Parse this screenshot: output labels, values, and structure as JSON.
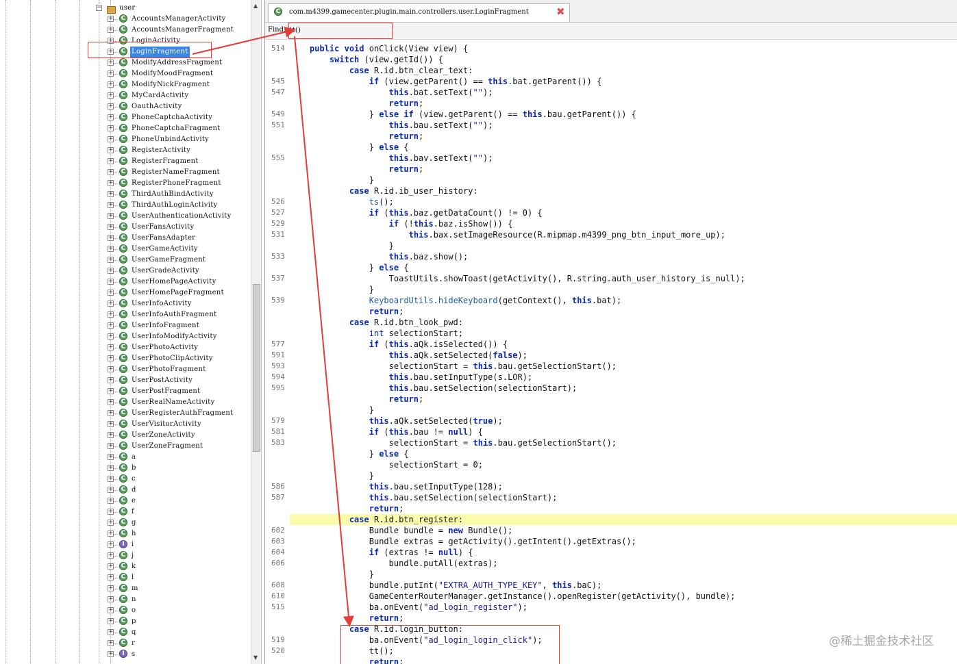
{
  "package_tree": {
    "root_label": "user",
    "nodes": [
      {
        "label": "AccountsManagerActivity",
        "kind": "class"
      },
      {
        "label": "AccountsManagerFragment",
        "kind": "class"
      },
      {
        "label": "LoginActivity",
        "kind": "class"
      },
      {
        "label": "LoginFragment",
        "kind": "class",
        "selected": true
      },
      {
        "label": "ModifyAddressFragment",
        "kind": "class"
      },
      {
        "label": "ModifyMoodFragment",
        "kind": "class"
      },
      {
        "label": "ModifyNickFragment",
        "kind": "class"
      },
      {
        "label": "MyCardActivity",
        "kind": "class"
      },
      {
        "label": "OauthActivity",
        "kind": "class"
      },
      {
        "label": "PhoneCaptchaActivity",
        "kind": "class"
      },
      {
        "label": "PhoneCaptchaFragment",
        "kind": "class"
      },
      {
        "label": "PhoneUnbindActivity",
        "kind": "class"
      },
      {
        "label": "RegisterActivity",
        "kind": "class"
      },
      {
        "label": "RegisterFragment",
        "kind": "class"
      },
      {
        "label": "RegisterNameFragment",
        "kind": "class"
      },
      {
        "label": "RegisterPhoneFragment",
        "kind": "class"
      },
      {
        "label": "ThirdAuthBindActivity",
        "kind": "class"
      },
      {
        "label": "ThirdAuthLoginActivity",
        "kind": "class"
      },
      {
        "label": "UserAuthenticationActivity",
        "kind": "class"
      },
      {
        "label": "UserFansActivity",
        "kind": "class"
      },
      {
        "label": "UserFansAdapter",
        "kind": "class"
      },
      {
        "label": "UserGameActivity",
        "kind": "class"
      },
      {
        "label": "UserGameFragment",
        "kind": "class"
      },
      {
        "label": "UserGradeActivity",
        "kind": "class"
      },
      {
        "label": "UserHomePageActivity",
        "kind": "class"
      },
      {
        "label": "UserHomePageFragment",
        "kind": "class"
      },
      {
        "label": "UserInfoActivity",
        "kind": "class"
      },
      {
        "label": "UserInfoAuthFragment",
        "kind": "class"
      },
      {
        "label": "UserInfoFragment",
        "kind": "class"
      },
      {
        "label": "UserInfoModifyActivity",
        "kind": "class"
      },
      {
        "label": "UserPhotoActivity",
        "kind": "class"
      },
      {
        "label": "UserPhotoClipActivity",
        "kind": "class"
      },
      {
        "label": "UserPhotoFragment",
        "kind": "class"
      },
      {
        "label": "UserPostActivity",
        "kind": "class"
      },
      {
        "label": "UserPostFragment",
        "kind": "class"
      },
      {
        "label": "UserRealNameActivity",
        "kind": "class"
      },
      {
        "label": "UserRegisterAuthFragment",
        "kind": "class"
      },
      {
        "label": "UserVisitorActivity",
        "kind": "class"
      },
      {
        "label": "UserZoneActivity",
        "kind": "class"
      },
      {
        "label": "UserZoneFragment",
        "kind": "class"
      },
      {
        "label": "a",
        "kind": "class"
      },
      {
        "label": "b",
        "kind": "class"
      },
      {
        "label": "c",
        "kind": "class"
      },
      {
        "label": "d",
        "kind": "class"
      },
      {
        "label": "e",
        "kind": "class"
      },
      {
        "label": "f",
        "kind": "class"
      },
      {
        "label": "g",
        "kind": "class"
      },
      {
        "label": "h",
        "kind": "class"
      },
      {
        "label": "i",
        "kind": "interface"
      },
      {
        "label": "j",
        "kind": "class"
      },
      {
        "label": "k",
        "kind": "class"
      },
      {
        "label": "l",
        "kind": "class"
      },
      {
        "label": "m",
        "kind": "class"
      },
      {
        "label": "n",
        "kind": "class"
      },
      {
        "label": "o",
        "kind": "class"
      },
      {
        "label": "p",
        "kind": "class"
      },
      {
        "label": "q",
        "kind": "class"
      },
      {
        "label": "r",
        "kind": "class"
      },
      {
        "label": "s",
        "kind": "interface"
      }
    ]
  },
  "editor": {
    "tab_title": "com.m4399.gamecenter.plugin.main.controllers.user.LoginFragment",
    "find_label": "Find:",
    "find_value": "tt()",
    "highlight_color": "#fbfbaa",
    "lines": [
      {
        "n": "514",
        "indent": 1,
        "html": "<span class='kw'>public</span> <span class='kw'>void</span> onClick(View view) {"
      },
      {
        "n": "",
        "indent": 2,
        "html": "<span class='kw'>switch</span> (view.getId()) {"
      },
      {
        "n": "",
        "indent": 3,
        "html": "<span class='kw'>case</span> R.id.btn_clear_text:"
      },
      {
        "n": "545",
        "indent": 4,
        "html": "<span class='kw'>if</span> (view.getParent() == <span class='kw'>this</span>.bat.getParent()) {"
      },
      {
        "n": "547",
        "indent": 5,
        "html": "<span class='kw'>this</span>.bat.setText(<span class='st'>\"\"</span>);"
      },
      {
        "n": "",
        "indent": 5,
        "html": "<span class='kw'>return</span>;"
      },
      {
        "n": "549",
        "indent": 4,
        "html": "} <span class='kw'>else if</span> (view.getParent() == <span class='kw'>this</span>.bau.getParent()) {"
      },
      {
        "n": "551",
        "indent": 5,
        "html": "<span class='kw'>this</span>.bau.setText(<span class='st'>\"\"</span>);"
      },
      {
        "n": "",
        "indent": 5,
        "html": "<span class='kw'>return</span>;"
      },
      {
        "n": "",
        "indent": 4,
        "html": "} <span class='kw'>else</span> {"
      },
      {
        "n": "555",
        "indent": 5,
        "html": "<span class='kw'>this</span>.bav.setText(<span class='st'>\"\"</span>);"
      },
      {
        "n": "",
        "indent": 5,
        "html": "<span class='kw'>return</span>;"
      },
      {
        "n": "",
        "indent": 4,
        "html": "}"
      },
      {
        "n": "",
        "indent": 3,
        "html": "<span class='kw'>case</span> R.id.ib_user_history:"
      },
      {
        "n": "526",
        "indent": 4,
        "html": "<span class='fn'>ts</span>();"
      },
      {
        "n": "527",
        "indent": 4,
        "html": "<span class='kw'>if</span> (<span class='kw'>this</span>.baz.getDataCount() != 0) {"
      },
      {
        "n": "529",
        "indent": 5,
        "html": "<span class='kw'>if</span> (!<span class='kw'>this</span>.baz.isShow()) {"
      },
      {
        "n": "531",
        "indent": 6,
        "html": "<span class='kw'>this</span>.bax.setImageResource(R.mipmap.m4399_png_btn_input_more_up);"
      },
      {
        "n": "",
        "indent": 5,
        "html": "}"
      },
      {
        "n": "533",
        "indent": 5,
        "html": "<span class='kw'>this</span>.baz.show();"
      },
      {
        "n": "",
        "indent": 4,
        "html": "} <span class='kw'>else</span> {"
      },
      {
        "n": "537",
        "indent": 5,
        "html": "ToastUtils.showToast(getActivity(), R.string.auth_user_history_is_null);"
      },
      {
        "n": "",
        "indent": 4,
        "html": "}"
      },
      {
        "n": "539",
        "indent": 4,
        "html": "<span class='fn'>KeyboardUtils.hideKeyboard</span>(getContext(), <span class='kw'>this</span>.bat);"
      },
      {
        "n": "",
        "indent": 4,
        "html": "<span class='kw'>return</span>;"
      },
      {
        "n": "",
        "indent": 3,
        "html": "<span class='kw'>case</span> R.id.btn_look_pwd:"
      },
      {
        "n": "",
        "indent": 4,
        "html": "<span class='ty'>int</span> selectionStart;"
      },
      {
        "n": "577",
        "indent": 4,
        "html": "<span class='kw'>if</span> (<span class='kw'>this</span>.aQk.isSelected()) {"
      },
      {
        "n": "591",
        "indent": 5,
        "html": "<span class='kw'>this</span>.aQk.setSelected(<span class='kw'>false</span>);"
      },
      {
        "n": "593",
        "indent": 5,
        "html": "selectionStart = <span class='kw'>this</span>.bau.getSelectionStart();"
      },
      {
        "n": "594",
        "indent": 5,
        "html": "<span class='kw'>this</span>.bau.setInputType(s.LOR);"
      },
      {
        "n": "595",
        "indent": 5,
        "html": "<span class='kw'>this</span>.bau.setSelection(selectionStart);"
      },
      {
        "n": "",
        "indent": 5,
        "html": "<span class='kw'>return</span>;"
      },
      {
        "n": "",
        "indent": 4,
        "html": "}"
      },
      {
        "n": "579",
        "indent": 4,
        "html": "<span class='kw'>this</span>.aQk.setSelected(<span class='kw'>true</span>);"
      },
      {
        "n": "581",
        "indent": 4,
        "html": "<span class='kw'>if</span> (<span class='kw'>this</span>.bau != <span class='kw'>null</span>) {"
      },
      {
        "n": "583",
        "indent": 5,
        "html": "selectionStart = <span class='kw'>this</span>.bau.getSelectionStart();"
      },
      {
        "n": "",
        "indent": 4,
        "html": "} <span class='kw'>else</span> {"
      },
      {
        "n": "",
        "indent": 5,
        "html": "selectionStart = 0;"
      },
      {
        "n": "",
        "indent": 4,
        "html": "}"
      },
      {
        "n": "586",
        "indent": 4,
        "html": "<span class='kw'>this</span>.bau.setInputType(128);"
      },
      {
        "n": "587",
        "indent": 4,
        "html": "<span class='kw'>this</span>.bau.setSelection(selectionStart);"
      },
      {
        "n": "",
        "indent": 4,
        "html": "<span class='kw'>return</span>;"
      },
      {
        "n": "",
        "indent": 3,
        "html": "<span class='kw'>case</span> R.id.btn_register:",
        "highlight": true
      },
      {
        "n": "602",
        "indent": 4,
        "html": "Bundle bundle = <span class='kw'>new</span> Bundle();"
      },
      {
        "n": "603",
        "indent": 4,
        "html": "Bundle extras = getActivity().getIntent().getExtras();"
      },
      {
        "n": "604",
        "indent": 4,
        "html": "<span class='kw'>if</span> (extras != <span class='kw'>null</span>) {"
      },
      {
        "n": "606",
        "indent": 5,
        "html": "bundle.putAll(extras);"
      },
      {
        "n": "",
        "indent": 4,
        "html": "}"
      },
      {
        "n": "608",
        "indent": 4,
        "html": "bundle.putInt(<span class='st'>\"EXTRA_AUTH_TYPE_KEY\"</span>, <span class='kw'>this</span>.baC);"
      },
      {
        "n": "610",
        "indent": 4,
        "html": "GameCenterRouterManager.getInstance().openRegister(getActivity(), bundle);"
      },
      {
        "n": "515",
        "indent": 4,
        "html": "ba.onEvent(<span class='st'>\"ad_login_register\"</span>);"
      },
      {
        "n": "",
        "indent": 4,
        "html": "<span class='kw'>return</span>;"
      },
      {
        "n": "",
        "indent": 3,
        "html": "<span class='kw'>case</span> R.id.login_button:"
      },
      {
        "n": "519",
        "indent": 4,
        "html": "ba.onEvent(<span class='st'>\"ad_login_login_click\"</span>);"
      },
      {
        "n": "520",
        "indent": 4,
        "html": "tt();"
      },
      {
        "n": "",
        "indent": 4,
        "html": "<span class='kw'>return</span>;"
      }
    ]
  },
  "watermark": "@稀土掘金技术社区",
  "annotation_color": "#e43b3b"
}
